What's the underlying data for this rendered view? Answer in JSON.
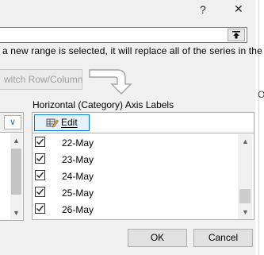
{
  "title_bar": {
    "help": "?",
    "close": "✕"
  },
  "range_input": {
    "value": ""
  },
  "info_text": "a new range is selected, it will replace all of the series in the",
  "switch_button": {
    "label": "witch Row/Column"
  },
  "axis_labels": {
    "title": "Horizontal (Category) Axis Labels",
    "edit_label": "Edit",
    "items": [
      {
        "label": "22-May",
        "checked": true
      },
      {
        "label": "23-May",
        "checked": true
      },
      {
        "label": "24-May",
        "checked": true
      },
      {
        "label": "25-May",
        "checked": true
      },
      {
        "label": "26-May",
        "checked": true
      }
    ]
  },
  "left_pane": {
    "dropdown_glyph": "∨"
  },
  "scroll": {
    "up": "▲",
    "down": "▼"
  },
  "background_fragment": "O",
  "buttons": {
    "ok": "OK",
    "cancel": "Cancel"
  },
  "colors": {
    "accent": "#0078d7",
    "dialog_bg": "#f0f0f0"
  }
}
